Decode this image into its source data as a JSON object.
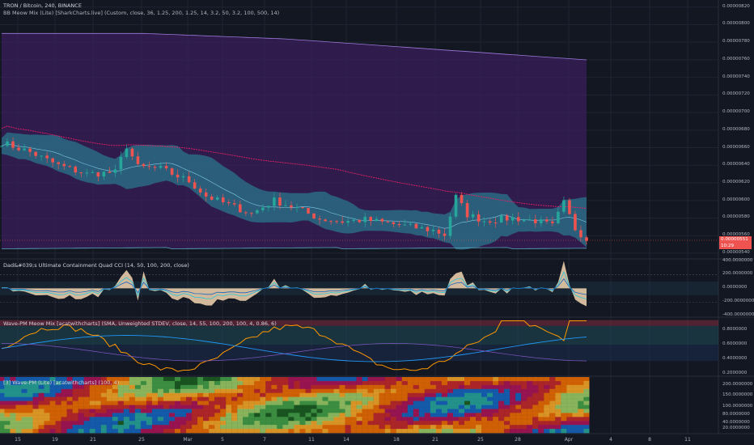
{
  "header": {
    "symbol_line": "TRON / Bitcoin, 240, BINANCE",
    "bb_indicator": "BB Meow Mix (Lite) [SharkCharts.live] (Custom, close, 36, 1.25, 200, 1.25, 14, 3.2, 50, 3.2, 100, 500, 14)"
  },
  "colors": {
    "background": "#131722",
    "up_candle": "#26a69a",
    "down_candle": "#ef5350",
    "outer_band_fill": "#3a1f5c",
    "inner_band_fill": "#2a6f87",
    "slow_ma": "#e91e63",
    "cci_fill": "#f5d6b0",
    "wave_line": "#ff9800",
    "wave_mid": "#2196f3"
  },
  "price_tags": [
    "0.00000551",
    "10:29"
  ],
  "chart_data": [
    {
      "type": "line",
      "title": "TRON / Bitcoin, 240, BINANCE",
      "y_ticks": [
        "0.00000820",
        "0.00000800",
        "0.00000780",
        "0.00000760",
        "0.00000740",
        "0.00000720",
        "0.00000700",
        "0.00000680",
        "0.00000660",
        "0.00000640",
        "0.00000620",
        "0.00000600",
        "0.00000580",
        "0.00000560",
        "0.00000540"
      ],
      "ylim": [
        5.335e-06,
        8.28e-06
      ],
      "x_ticks": [
        "15",
        "19",
        "21",
        "25",
        "Mar",
        "5",
        "7",
        "11",
        "14",
        "18",
        "21",
        "25",
        "28",
        "Apr",
        "4",
        "8",
        "11"
      ],
      "approx_close_path": [
        [
          0,
          6.66e-06
        ],
        [
          5,
          6.55e-06
        ],
        [
          10,
          6.4e-06
        ],
        [
          15,
          6.3e-06
        ],
        [
          20,
          6.32e-06
        ],
        [
          22,
          6.62e-06
        ],
        [
          24,
          6.38e-06
        ],
        [
          28,
          6.36e-06
        ],
        [
          33,
          6.22e-06
        ],
        [
          36,
          6.05e-06
        ],
        [
          40,
          5.95e-06
        ],
        [
          44,
          5.85e-06
        ],
        [
          48,
          6e-06
        ],
        [
          52,
          5.91e-06
        ],
        [
          56,
          5.79e-06
        ],
        [
          60,
          5.76e-06
        ],
        [
          64,
          5.78e-06
        ],
        [
          68,
          5.74e-06
        ],
        [
          72,
          5.7e-06
        ],
        [
          76,
          5.66e-06
        ],
        [
          78,
          5.61e-06
        ],
        [
          80,
          6.04e-06
        ],
        [
          82,
          5.84e-06
        ],
        [
          85,
          5.77e-06
        ],
        [
          90,
          5.8e-06
        ],
        [
          94,
          5.77e-06
        ],
        [
          97,
          5.71e-06
        ],
        [
          99,
          5.97e-06
        ],
        [
          101,
          5.68e-06
        ],
        [
          103,
          5.56e-06
        ]
      ]
    },
    {
      "type": "area",
      "title": "Dad&#039;s Ultimate Containment Quad CCI (14, 50, 100, 200, close)",
      "y_ticks": [
        "400.0000000",
        "200.0000000",
        "0.0000000",
        "-200.0000000",
        "-400.0000000"
      ],
      "ylim": [
        -420,
        430
      ]
    },
    {
      "type": "line",
      "title": "Wave-PM Meow Mix [acatwithcharts] (SMA, Unweighted STDEV, close, 14, 55, 100, 200, 100, 4, 0.86, 6)",
      "y_ticks": [
        "0.8000000",
        "0.6000000",
        "0.4000000",
        "0.2000000"
      ],
      "ylim": [
        0.17,
        0.98
      ]
    },
    {
      "type": "heatmap",
      "title": "[3] Wave-PM (Lite) [acatwithcharts] (100, 4)",
      "y_ticks": [
        "200.0000000",
        "150.0000000",
        "100.0000000",
        "80.0000000",
        "40.0000000",
        "20.0000000"
      ]
    }
  ]
}
